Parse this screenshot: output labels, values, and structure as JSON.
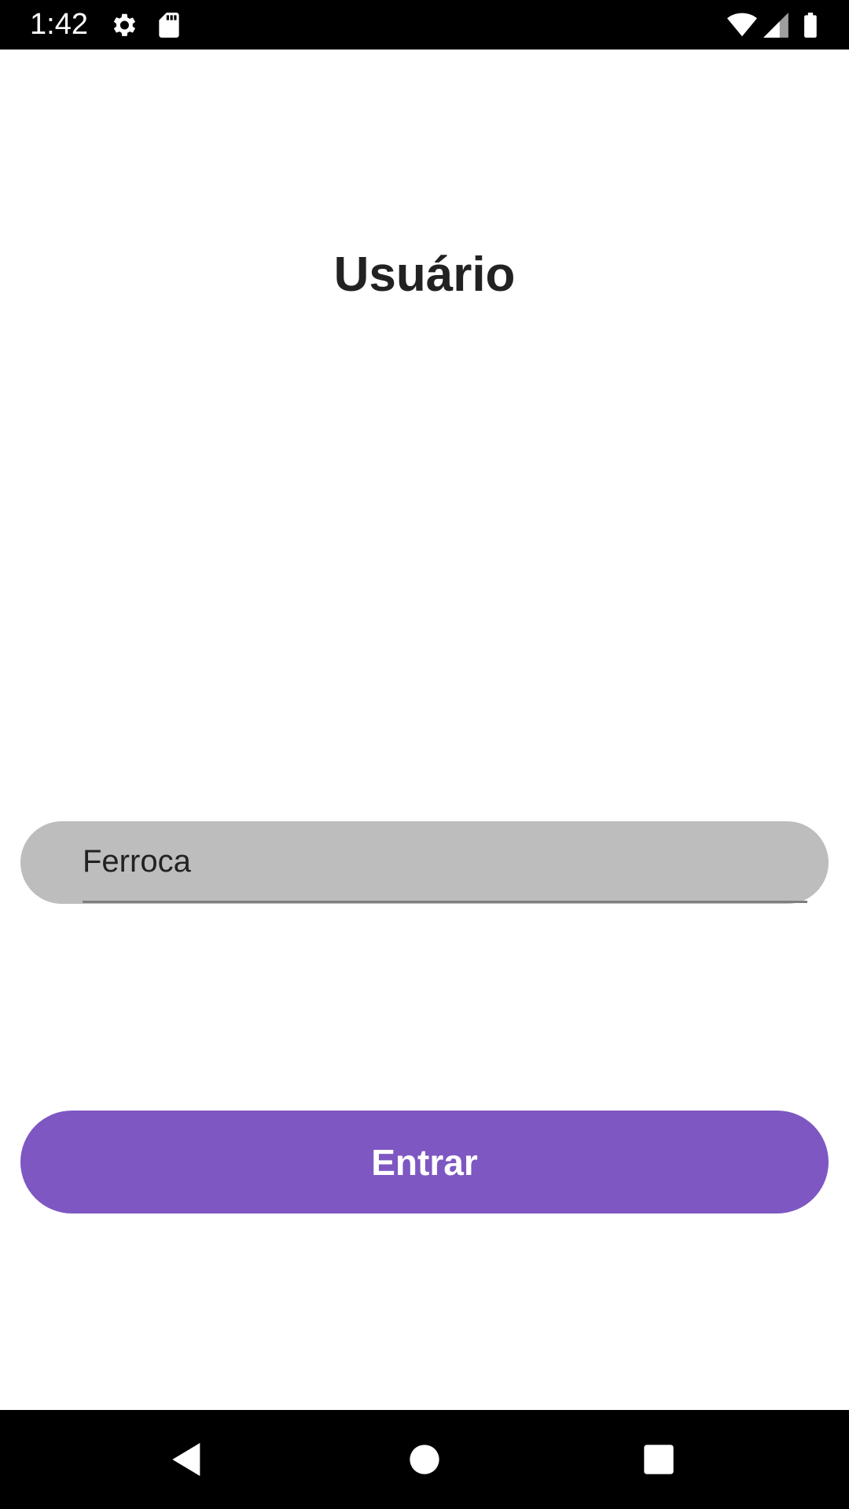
{
  "status_bar": {
    "time": "1:42",
    "icons": [
      "gear-icon",
      "sd-card-icon",
      "wifi-icon",
      "cell-signal-icon",
      "battery-icon"
    ]
  },
  "main": {
    "title": "Usuário",
    "username_input": {
      "value": "Ferroca"
    },
    "enter_button_label": "Entrar"
  },
  "nav_bar": {
    "buttons": [
      "back-icon",
      "home-icon",
      "recents-icon"
    ]
  },
  "colors": {
    "accent": "#7e57c2",
    "input_background": "#bdbdbd",
    "status_bar": "#000000",
    "nav_bar": "#000000"
  }
}
